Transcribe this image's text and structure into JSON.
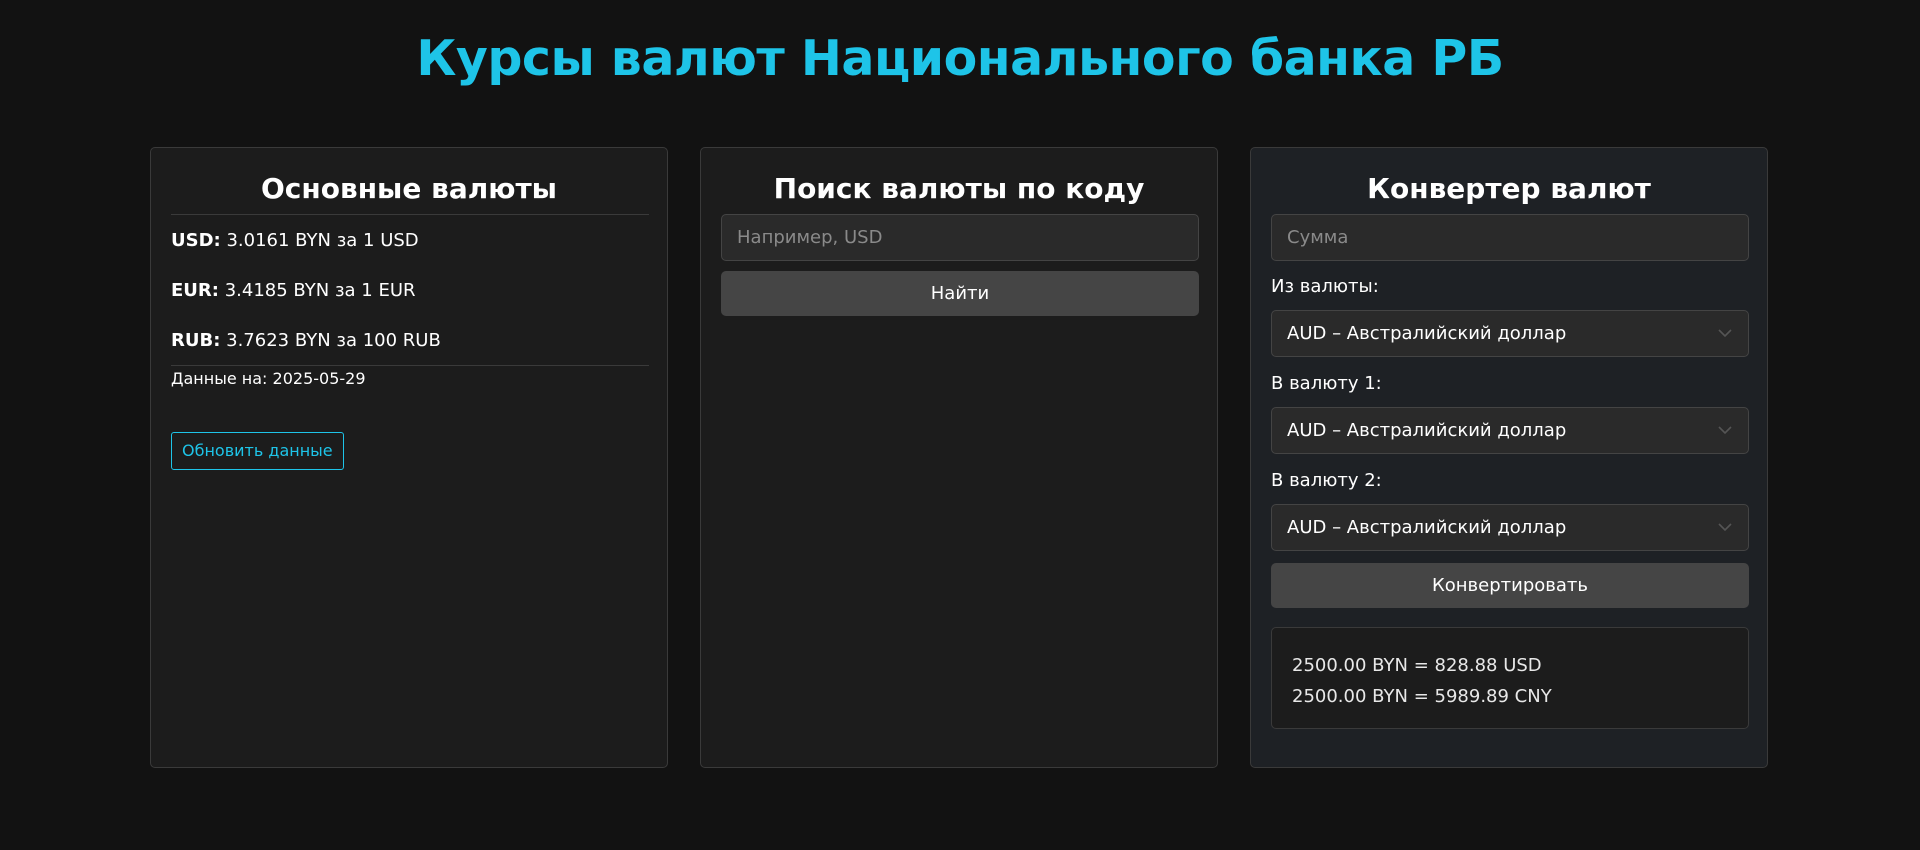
{
  "page": {
    "title": "Курсы валют Национального банка РБ"
  },
  "main_currencies": {
    "title": "Основные валюты",
    "rates": [
      {
        "code": "USD:",
        "text": " 3.0161 BYN за 1 USD"
      },
      {
        "code": "EUR:",
        "text": " 3.4185 BYN за 1 EUR"
      },
      {
        "code": "RUB:",
        "text": " 3.7623 BYN за 100 RUB"
      }
    ],
    "date_text": "Данные на: 2025-05-29",
    "refresh_label": "Обновить данные"
  },
  "search": {
    "title": "Поиск валюты по коду",
    "placeholder": "Например, USD",
    "button_label": "Найти"
  },
  "converter": {
    "title": "Конвертер валют",
    "amount_placeholder": "Сумма",
    "from_label": "Из валюты:",
    "from_value": "AUD – Австралийский доллар",
    "to1_label": "В валюту 1:",
    "to1_value": "AUD – Австралийский доллар",
    "to2_label": "В валюту 2:",
    "to2_value": "AUD – Австралийский доллар",
    "button_label": "Конвертировать",
    "results": [
      "2500.00 BYN = 828.88 USD",
      "2500.00 BYN = 5989.89 CNY"
    ]
  },
  "icons": {
    "select_arrow": "chevron-down-icon"
  },
  "colors": {
    "accent": "#1ec4e8",
    "background": "#121212",
    "card": "#1c1c1c",
    "button": "#454545"
  }
}
